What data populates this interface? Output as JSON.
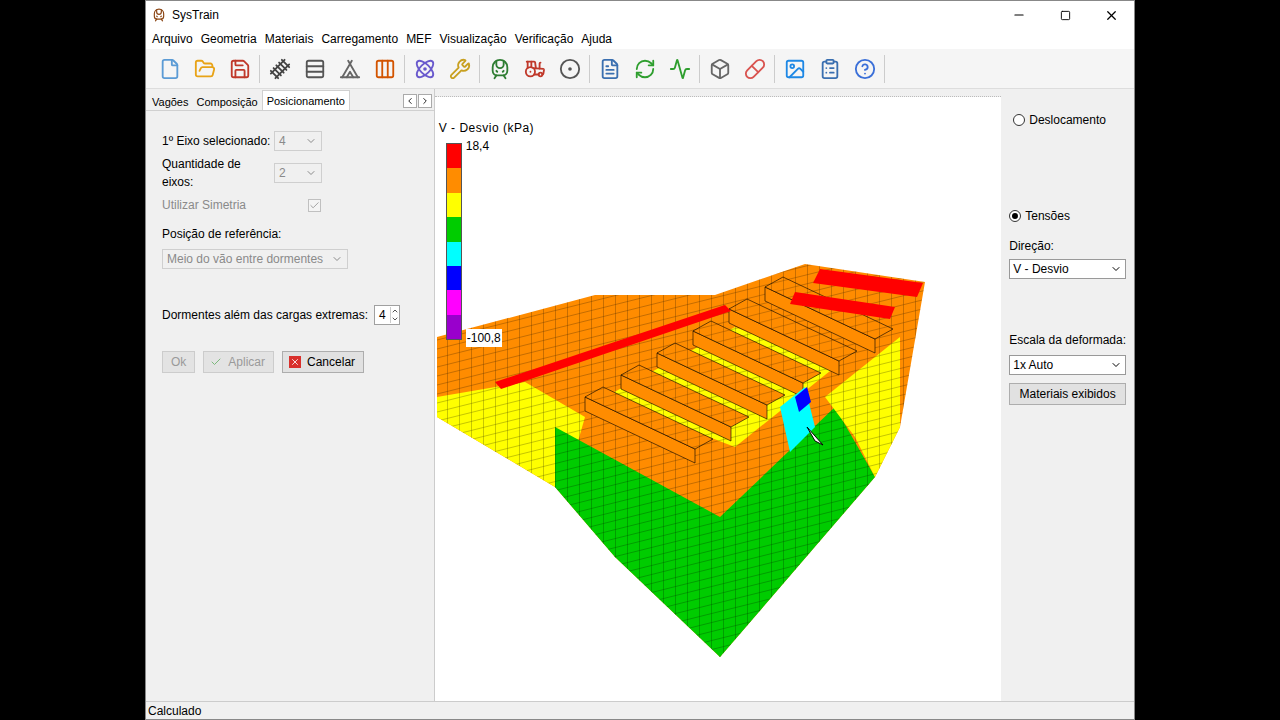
{
  "window": {
    "title": "SysTrain"
  },
  "menu": [
    "Arquivo",
    "Geometria",
    "Materiais",
    "Carregamento",
    "MEF",
    "Visualização",
    "Verificação",
    "Ajuda"
  ],
  "tabs": [
    {
      "label": "Vagões",
      "selected": false
    },
    {
      "label": "Composição",
      "selected": false
    },
    {
      "label": "Posicionamento",
      "selected": true
    }
  ],
  "form": {
    "fields": [
      {
        "label": "1º Eixo selecionado:",
        "value": "4",
        "kind": "select",
        "disabled": true
      },
      {
        "label": "Quantidade de eixos:",
        "value": "2",
        "kind": "select",
        "disabled": true
      },
      {
        "label": "Utilizar Simetria",
        "kind": "checkbox",
        "checked": true,
        "disabled": true
      },
      {
        "label": "Posição de referência:",
        "value": "Meio do vão entre dormentes",
        "kind": "wideselect",
        "disabled": true
      },
      {
        "label": "Dormentes além das cargas extremas:",
        "value": "4",
        "kind": "spinner",
        "disabled": false
      }
    ],
    "buttons": [
      {
        "label": "Ok",
        "disabled": true
      },
      {
        "label": "Aplicar",
        "disabled": true
      },
      {
        "label": "Cancelar",
        "disabled": false
      }
    ]
  },
  "plot": {
    "title": "V - Desvio (kPa)",
    "max": "18,4",
    "min": "-100,8",
    "legend": [
      {
        "color": "#ff0000"
      },
      {
        "color": "#ff8c00"
      },
      {
        "color": "#ffff00"
      },
      {
        "color": "#00cc00"
      },
      {
        "color": "#00ffff"
      },
      {
        "color": "#0000ff"
      },
      {
        "color": "#ff00ff"
      },
      {
        "color": "#9900cc"
      }
    ]
  },
  "right_panel": {
    "modes": [
      {
        "label": "Deslocamento",
        "selected": false
      },
      {
        "label": "Tensões",
        "selected": true
      }
    ],
    "direction": {
      "label": "Direção:",
      "value": "V - Desvio"
    },
    "scale": {
      "label": "Escala da deformada:",
      "value": "1x Auto"
    },
    "button": "Materiais exibidos"
  },
  "status_bar": "Calculado"
}
